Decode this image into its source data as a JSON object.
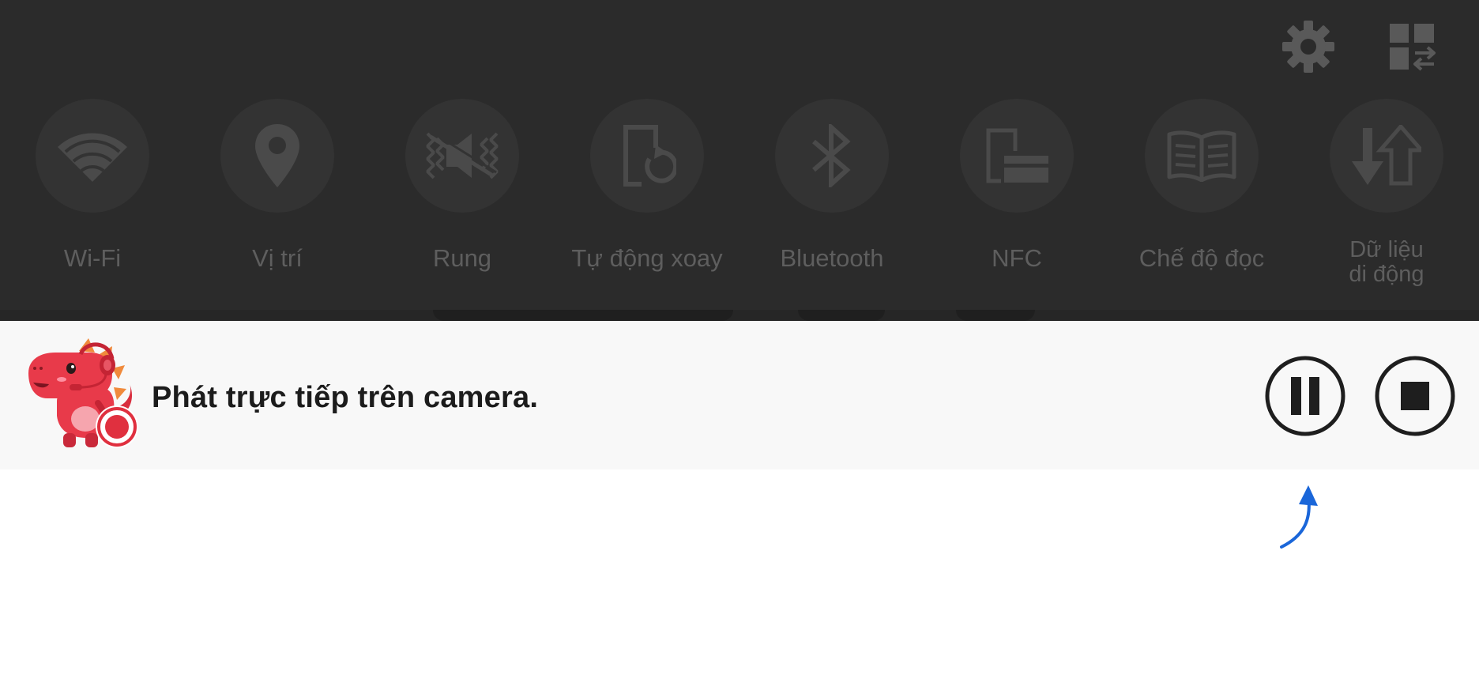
{
  "quick_settings": {
    "top_icons": [
      {
        "name": "gear-icon",
        "label": ""
      },
      {
        "name": "edit-tiles-icon",
        "label": ""
      }
    ],
    "tiles": [
      {
        "label": "Wi-Fi",
        "icon": "wifi-icon"
      },
      {
        "label": "Vị trí",
        "icon": "location-pin-icon"
      },
      {
        "label": "Rung",
        "icon": "vibrate-icon"
      },
      {
        "label": "Tự động xoay",
        "icon": "auto-rotate-icon"
      },
      {
        "label": "Bluetooth",
        "icon": "bluetooth-icon"
      },
      {
        "label": "NFC",
        "icon": "nfc-icon"
      },
      {
        "label": "Chế độ đọc",
        "icon": "reading-mode-icon"
      },
      {
        "label": "Dữ liệu\ndi động",
        "icon": "mobile-data-icon"
      }
    ]
  },
  "notification": {
    "text": "Phát trực tiếp trên camera.",
    "app_icon": "dino-mascot-recording-icon",
    "pause_icon": "pause-icon",
    "stop_icon": "stop-icon"
  },
  "hint": {
    "icon": "curved-arrow-up-icon"
  },
  "colors": {
    "panel_bg": "#2b2b2b",
    "tile_bg": "#333333",
    "tile_fg": "#5e5e5e",
    "notification_bg": "#f8f8f8",
    "mascot_red": "#e83a4a",
    "hint_blue": "#1a66d9"
  }
}
